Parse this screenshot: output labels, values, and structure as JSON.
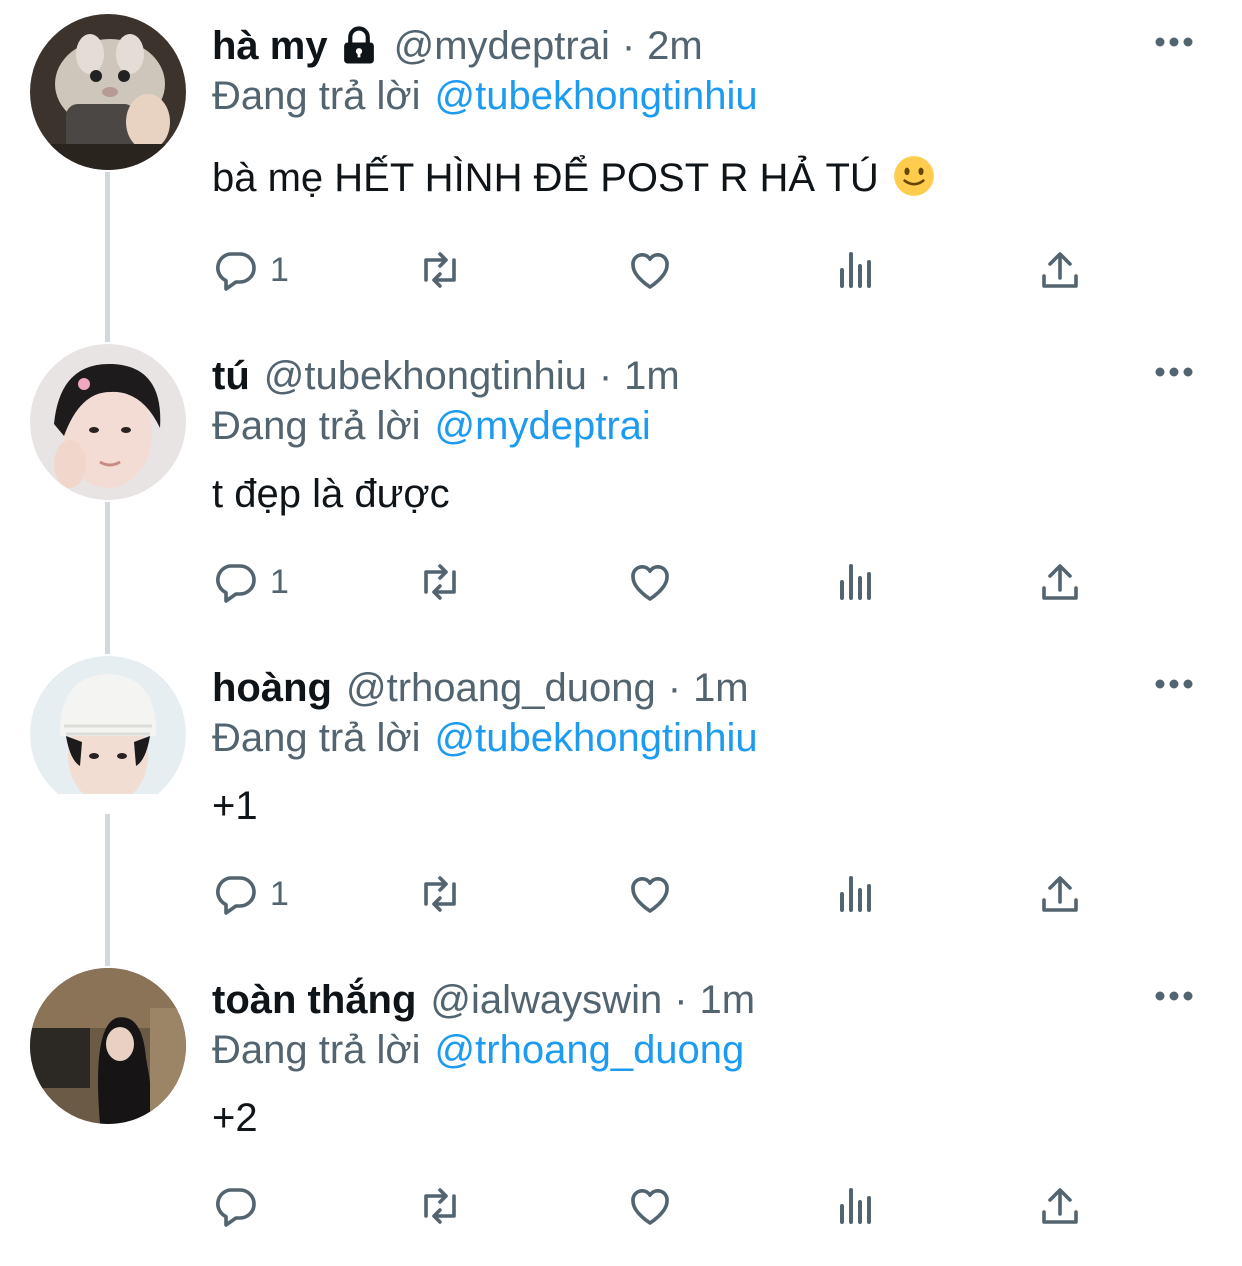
{
  "accent_color": "#1d9bf0",
  "muted_color": "#536471",
  "replying_prefix": "Đang trả lời",
  "tweets": [
    {
      "display_name": "hà my",
      "locked": true,
      "handle": "@mydeptrai",
      "separator": "·",
      "time": "2m",
      "reply_to": "@tubekhongtinhiu",
      "text": "bà mẹ HẾT HÌNH ĐỂ POST R HẢ TÚ",
      "emoji": "slightly-smiling-face",
      "reply_count": "1"
    },
    {
      "display_name": "tú",
      "locked": false,
      "handle": "@tubekhongtinhiu",
      "separator": "·",
      "time": "1m",
      "reply_to": "@mydeptrai",
      "text": "t đẹp là được",
      "reply_count": "1"
    },
    {
      "display_name": "hoàng",
      "locked": false,
      "handle": "@trhoang_duong",
      "separator": "·",
      "time": "1m",
      "reply_to": "@tubekhongtinhiu",
      "text": "+1",
      "reply_count": "1"
    },
    {
      "display_name": "toàn thắng",
      "locked": false,
      "handle": "@ialwayswin",
      "separator": "·",
      "time": "1m",
      "reply_to": "@trhoang_duong",
      "text": "+2",
      "reply_count": ""
    }
  ]
}
